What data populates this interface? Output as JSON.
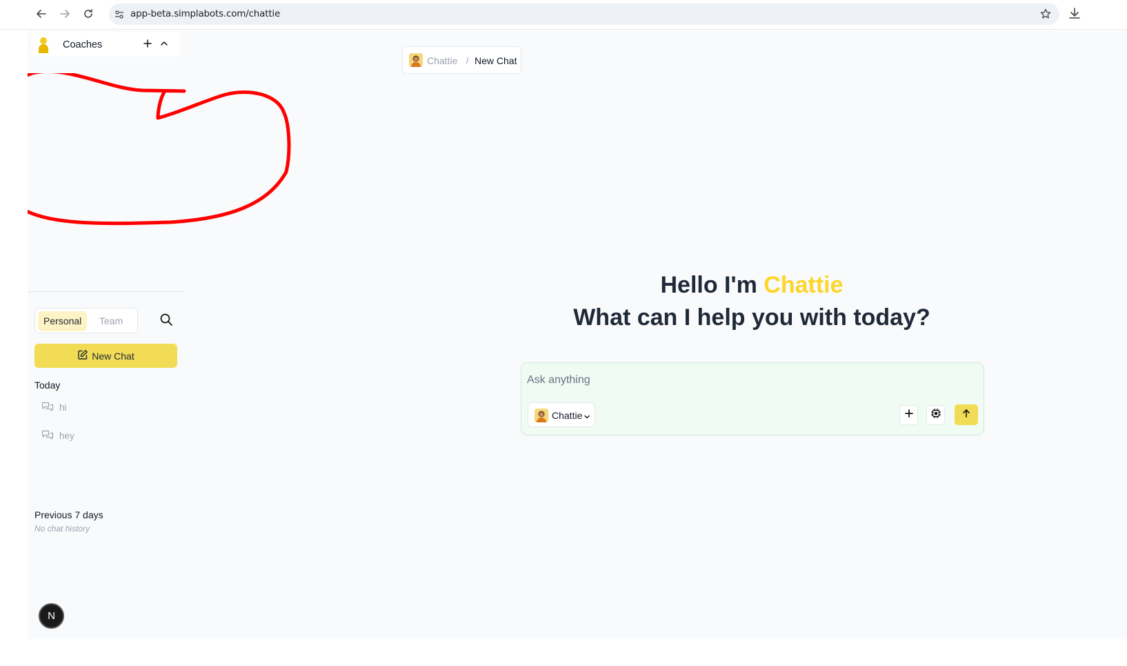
{
  "browser": {
    "url": "app-beta.simplabots.com/chattie"
  },
  "sidebar": {
    "coaches_label": "Coaches",
    "toggle": {
      "personal": "Personal",
      "team": "Team"
    },
    "new_chat_label": "New Chat",
    "today_label": "Today",
    "today_chats": [
      "hi",
      "hey"
    ],
    "previous_label": "Previous 7 days",
    "no_history": "No chat history",
    "badge_letter": "N"
  },
  "breadcrumb": {
    "bot": "Chattie",
    "separator": "/",
    "page": "New Chat"
  },
  "greeting": {
    "prefix": "Hello I'm ",
    "name": "Chattie",
    "line2": "What can I help you with today?"
  },
  "composer": {
    "placeholder": "Ask anything",
    "agent": "Chattie"
  },
  "colors": {
    "accent": "#f2dc55",
    "name_highlight": "#fcd62a",
    "annotation": "#ff0000"
  }
}
